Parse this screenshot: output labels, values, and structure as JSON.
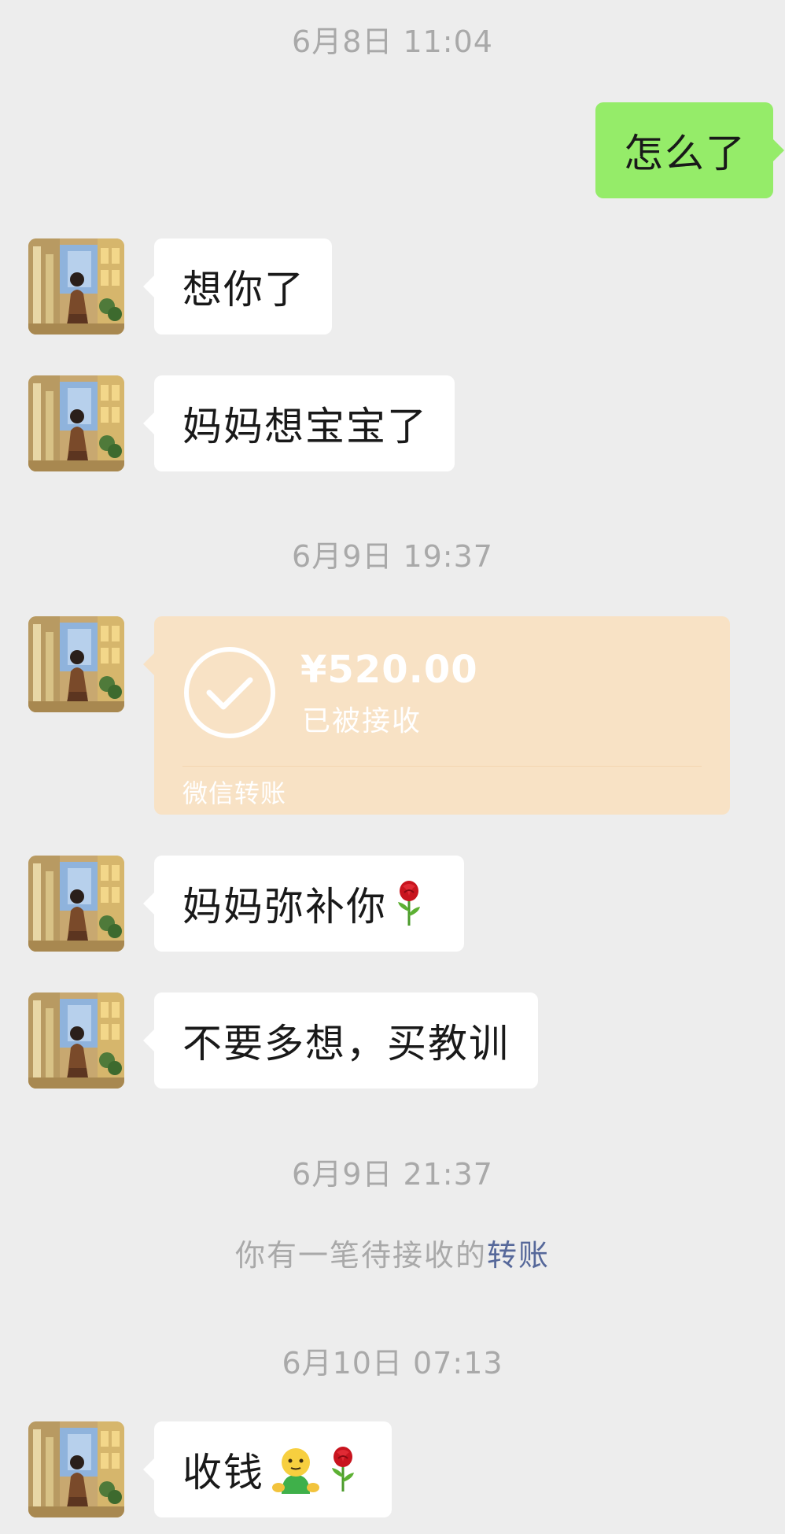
{
  "timestamps": [
    "6月8日 11:04",
    "6月9日 19:37",
    "6月9日 21:37",
    "6月10日 07:13"
  ],
  "messages": {
    "m1": "怎么了",
    "m2": "想你了",
    "m3": "妈妈想宝宝了",
    "m5": "妈妈弥补你",
    "m6": "不要多想，买教训",
    "m7": "收钱"
  },
  "transfer": {
    "amount": "¥520.00",
    "status": "已被接收",
    "label": "微信转账"
  },
  "system_notice": {
    "text": "你有一笔待接收的",
    "link": "转账"
  },
  "colors": {
    "background": "#ededed",
    "sent_bubble": "#95ec69",
    "received_bubble": "#ffffff",
    "transfer_bubble": "#f8e2c5",
    "timestamp_text": "#a9a9a9",
    "link_text": "#56689a"
  },
  "icons": [
    "rose-emoji-icon",
    "smiley-person-emoji-icon",
    "check-circle-icon"
  ]
}
